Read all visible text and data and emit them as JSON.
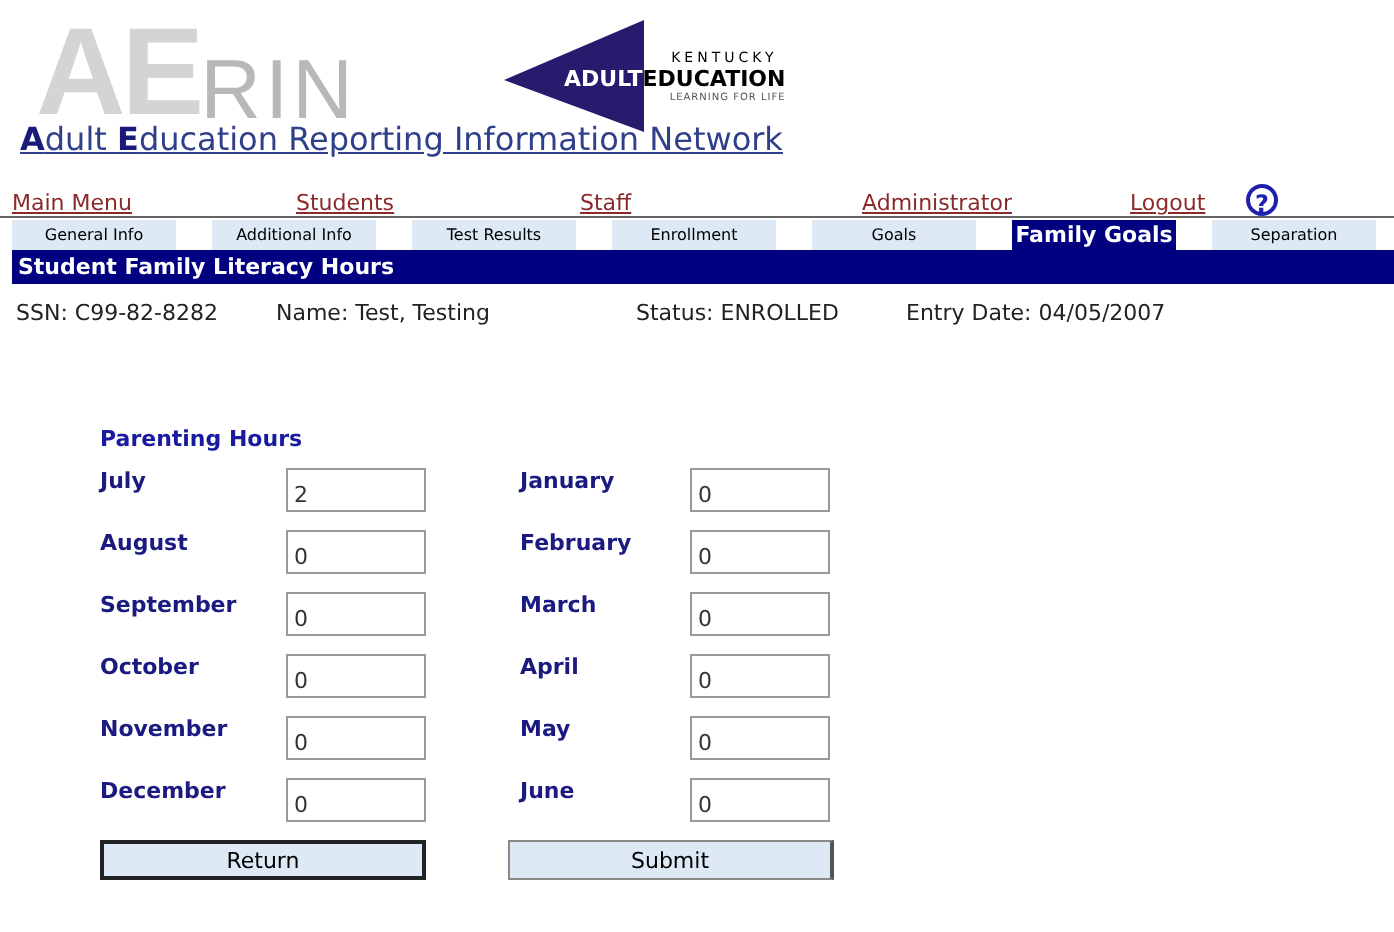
{
  "header": {
    "logo_large": "AE",
    "logo_small": "RIN",
    "partner_top": "KENTUCKY",
    "partner_left": "ADULT",
    "partner_right": "EDUCATION",
    "partner_tagline": "LEARNING FOR LIFE",
    "title": "**A**dult **E**ducation Reporting Information Network"
  },
  "nav": [
    "Main Menu",
    "Students",
    "Staff",
    "Administrator",
    "Logout"
  ],
  "help": {
    "label": "?"
  },
  "tabs": [
    {
      "label": "General Info",
      "selected": false
    },
    {
      "label": "Additional Info",
      "selected": false
    },
    {
      "label": "Test Results",
      "selected": false
    },
    {
      "label": "Enrollment",
      "selected": false
    },
    {
      "label": "Goals",
      "selected": false
    },
    {
      "label": "Family Goals",
      "selected": true
    },
    {
      "label": "Separation",
      "selected": false
    }
  ],
  "section_title": "Student Family Literacy Hours",
  "info": [
    "SSN: C99-82-8282",
    "Name: Test, Testing",
    "Status: ENROLLED",
    "Entry Date: 04/05/2007"
  ],
  "form": {
    "title": "Parenting Hours",
    "left": [
      {
        "month": "July",
        "value": "2"
      },
      {
        "month": "August",
        "value": "0"
      },
      {
        "month": "September",
        "value": "0"
      },
      {
        "month": "October",
        "value": "0"
      },
      {
        "month": "November",
        "value": "0"
      },
      {
        "month": "December",
        "value": "0"
      }
    ],
    "right": [
      {
        "month": "January",
        "value": "0"
      },
      {
        "month": "February",
        "value": "0"
      },
      {
        "month": "March",
        "value": "0"
      },
      {
        "month": "April",
        "value": "0"
      },
      {
        "month": "May",
        "value": "0"
      },
      {
        "month": "June",
        "value": "0"
      }
    ]
  },
  "buttons": [
    "Return",
    "Submit"
  ]
}
